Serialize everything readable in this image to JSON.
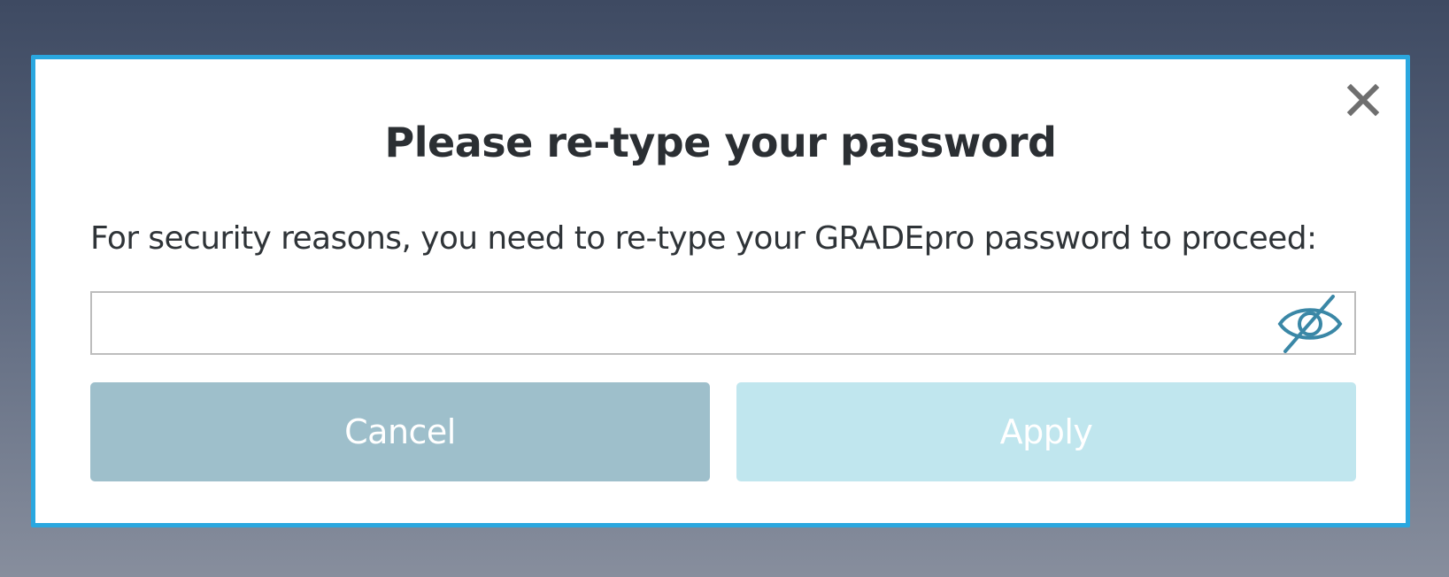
{
  "dialog": {
    "title": "Please re-type your password",
    "message": "For security reasons, you need to re-type your GRADEpro password to proceed:",
    "close_icon": "close-icon",
    "password": {
      "value": "",
      "placeholder": "",
      "toggle_icon": "eye-slash-icon"
    },
    "buttons": {
      "cancel_label": "Cancel",
      "apply_label": "Apply"
    }
  },
  "colors": {
    "modal_border": "#2aa7df",
    "cancel_bg": "#9ebfcb",
    "apply_bg": "#c0e6ee",
    "icon_teal": "#3a87a6",
    "close_gray": "#6f6f6f"
  }
}
